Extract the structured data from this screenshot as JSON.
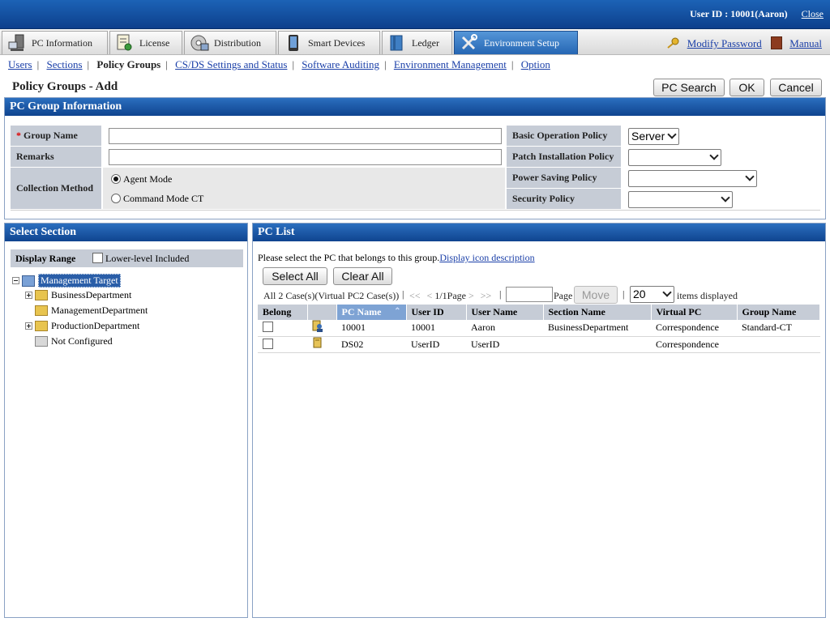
{
  "header": {
    "user_label": "User ID : 10001(Aaron)",
    "close_label": "Close"
  },
  "tabs": [
    {
      "label": "PC Information",
      "icon": "pc-icon",
      "active": false
    },
    {
      "label": "License",
      "icon": "license-icon",
      "active": false
    },
    {
      "label": "Distribution",
      "icon": "distribution-icon",
      "active": false
    },
    {
      "label": "Smart Devices",
      "icon": "smart-device-icon",
      "active": false
    },
    {
      "label": "Ledger",
      "icon": "ledger-icon",
      "active": false
    },
    {
      "label": "Environment Setup",
      "icon": "tools-icon",
      "active": true
    }
  ],
  "top_links": {
    "modify_password": "Modify Password",
    "manual": "Manual"
  },
  "submenu": [
    {
      "label": "Users",
      "current": false
    },
    {
      "label": "Sections",
      "current": false
    },
    {
      "label": "Policy Groups",
      "current": true
    },
    {
      "label": "CS/DS Settings and Status",
      "current": false
    },
    {
      "label": "Software Auditing",
      "current": false
    },
    {
      "label": "Environment Management",
      "current": false
    },
    {
      "label": "Option",
      "current": false
    }
  ],
  "page": {
    "title": "Policy Groups - Add",
    "buttons": {
      "pc_search": "PC Search",
      "ok": "OK",
      "cancel": "Cancel"
    }
  },
  "group_info": {
    "header": "PC Group Information",
    "required_mark": "*",
    "group_name_label": "Group Name",
    "group_name_value": "",
    "remarks_label": "Remarks",
    "remarks_value": "",
    "collection_label": "Collection Method",
    "collection_options": [
      "Agent Mode",
      "Command Mode CT"
    ],
    "collection_selected": "Agent Mode",
    "basic_op_label": "Basic Operation Policy",
    "basic_op_value": "Server",
    "patch_label": "Patch Installation Policy",
    "patch_value": "",
    "power_label": "Power Saving Policy",
    "power_value": "",
    "security_label": "Security Policy",
    "security_value": ""
  },
  "select_section": {
    "header": "Select Section",
    "display_range_label": "Display Range",
    "lower_level_label": "Lower-level Included",
    "lower_level_checked": false,
    "tree": {
      "root": "Management Target",
      "children": [
        {
          "label": "BusinessDepartment",
          "expandable": true
        },
        {
          "label": "ManagementDepartment",
          "expandable": false
        },
        {
          "label": "ProductionDepartment",
          "expandable": true
        },
        {
          "label": "Not Configured",
          "expandable": false
        }
      ]
    }
  },
  "pc_list": {
    "header": "PC List",
    "instruction": "Please select the PC that belongs to this group.",
    "icon_desc_link": "Display icon description",
    "select_all": "Select All",
    "clear_all": "Clear All",
    "count_text": "All 2 Case(s)(Virtual PC2 Case(s))",
    "first": "<<",
    "prev": "<",
    "page_info": "1/1Page",
    "next": ">",
    "last": ">>",
    "page_label": "Page",
    "page_input": "",
    "move_label": "Move",
    "per_page": "20",
    "items_displayed": "items displayed",
    "columns": [
      "Belong",
      "",
      "PC Name",
      "User ID",
      "User Name",
      "Section Name",
      "Virtual PC",
      "Group Name"
    ],
    "rows": [
      {
        "belong": false,
        "icon": "pc-user-icon",
        "pc_name": "10001",
        "user_id": "10001",
        "user_name": "Aaron",
        "section": "BusinessDepartment",
        "virtual": "Correspondence",
        "group": "Standard-CT"
      },
      {
        "belong": false,
        "icon": "pc-icon",
        "pc_name": "DS02",
        "user_id": "UserID",
        "user_name": "UserID",
        "section": "",
        "virtual": "Correspondence",
        "group": ""
      }
    ]
  }
}
